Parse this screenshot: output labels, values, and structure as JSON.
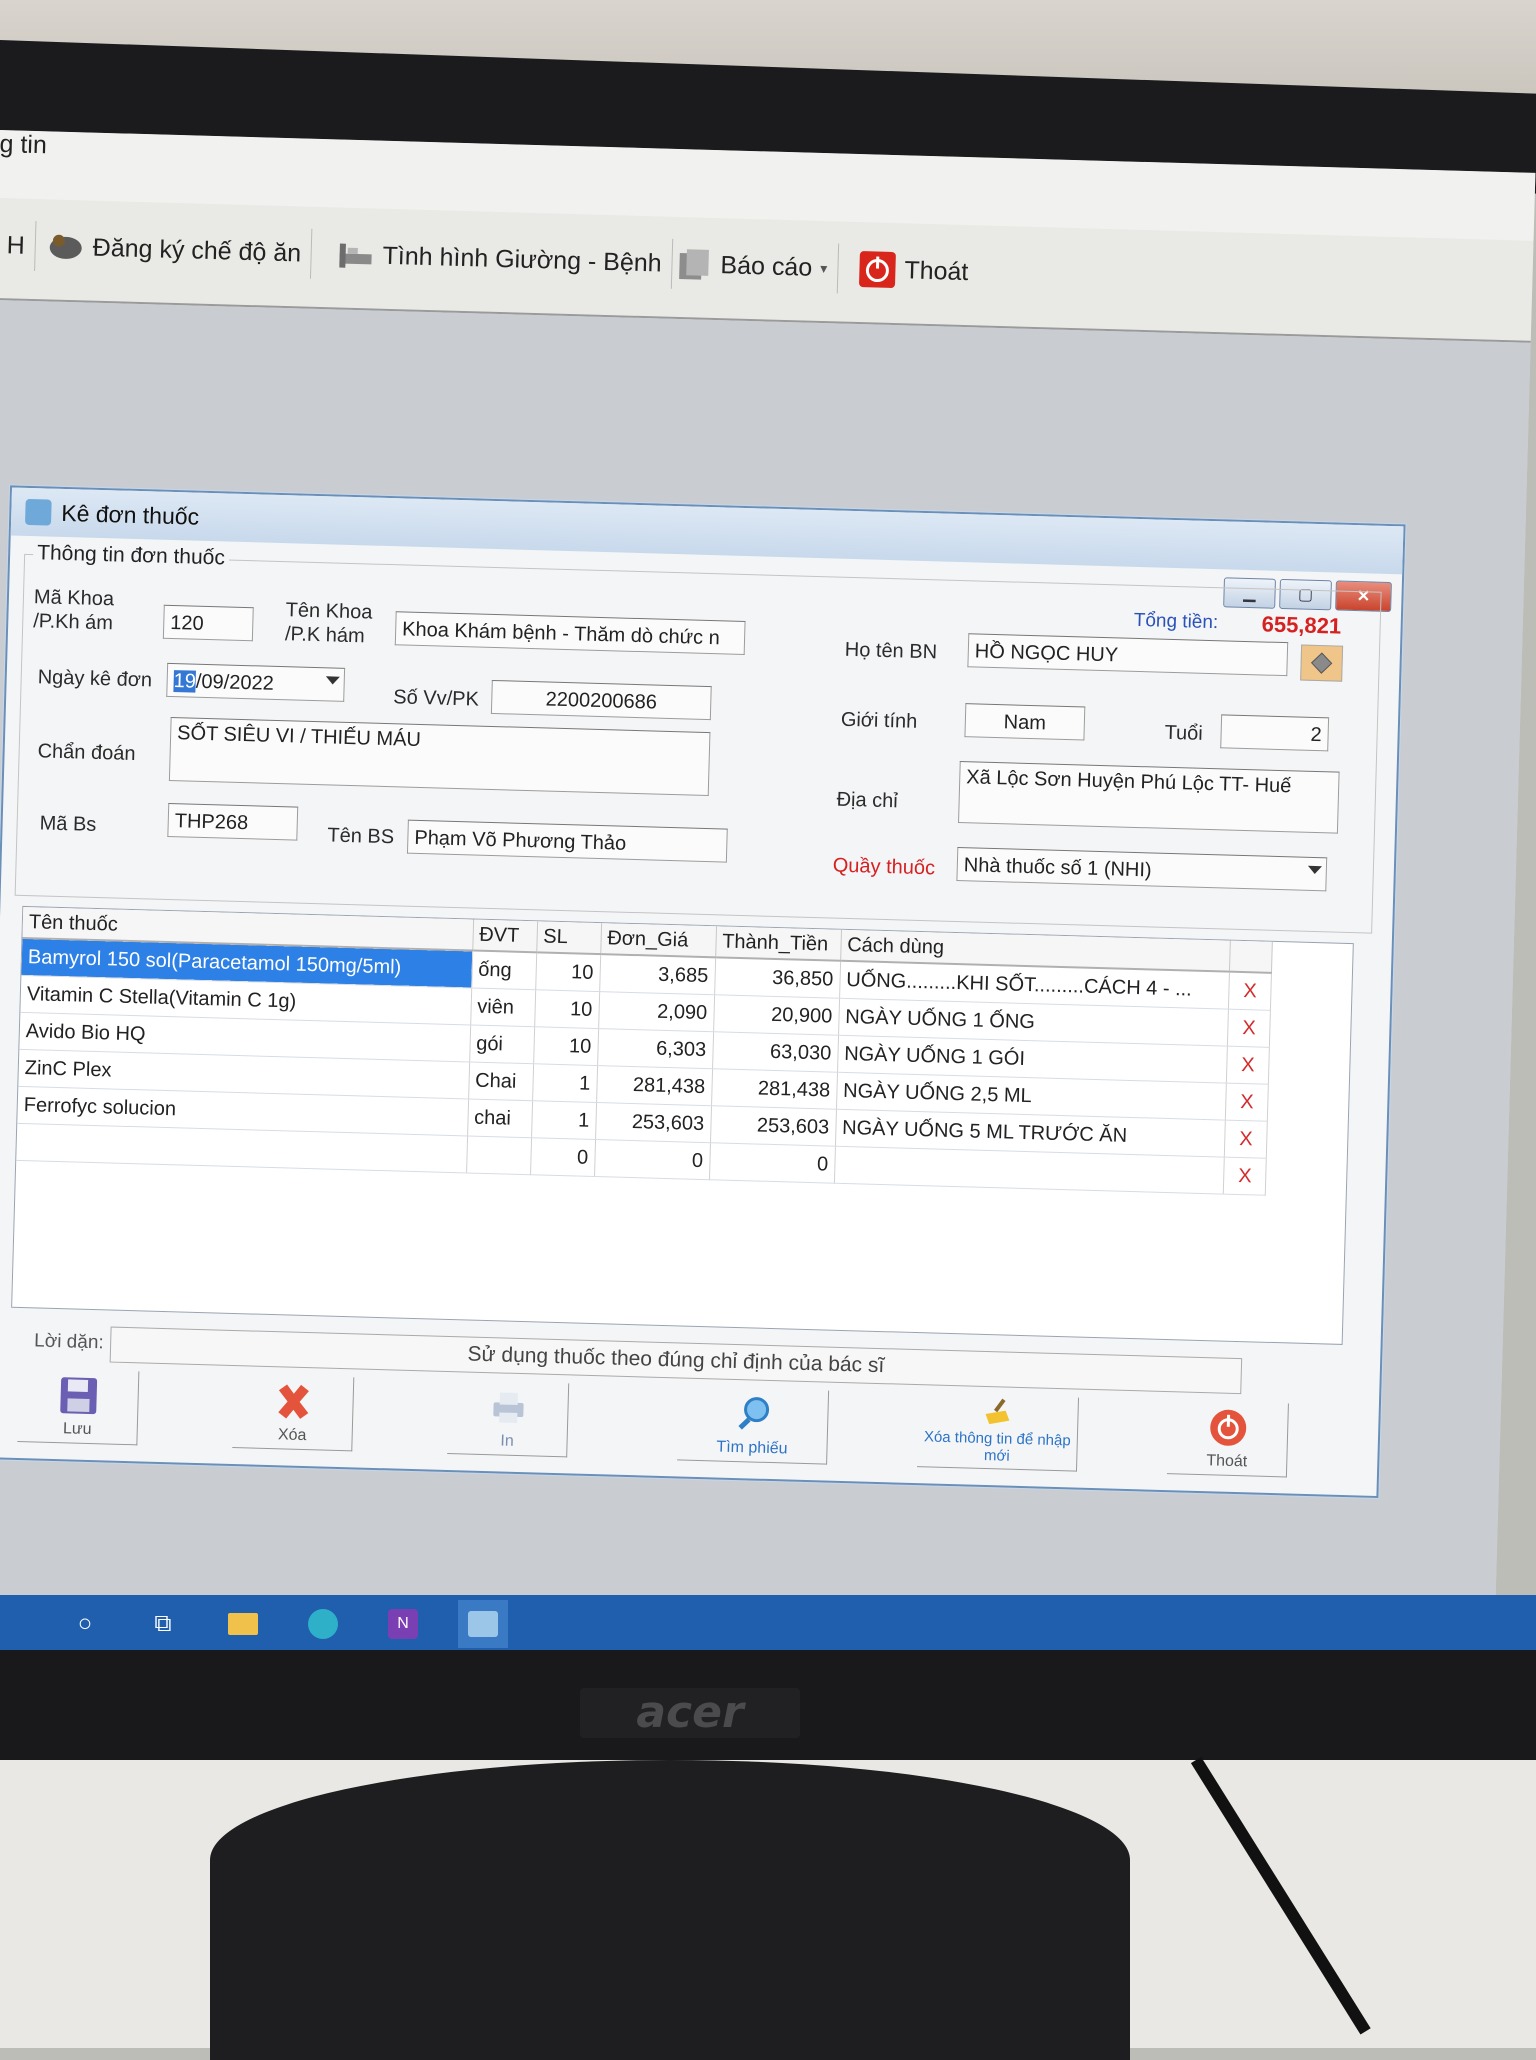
{
  "menubar": {
    "partial_label": "g tin"
  },
  "toolbar": {
    "items": [
      {
        "label": "H"
      },
      {
        "label": "Đăng ký chế độ ăn"
      },
      {
        "label": "Tình hình Giường - Bệnh"
      },
      {
        "label": "Báo cáo"
      },
      {
        "label": "Thoát"
      }
    ]
  },
  "dialog": {
    "title": "Kê đơn thuốc",
    "group_title": "Thông tin đơn thuốc",
    "total_label": "Tổng tiền:",
    "total_value": "655,821",
    "labels": {
      "ma_khoa": "Mã Khoa /P.Kh ám",
      "ten_khoa": "Tên Khoa /P.K hám",
      "ho_ten": "Họ tên BN",
      "ngay_ke_don": "Ngày kê đơn",
      "so_vv": "Số Vv/PK",
      "gioi_tinh": "Giới tính",
      "tuoi": "Tuổi",
      "chan_doan": "Chẩn đoán",
      "dia_chi": "Địa chỉ",
      "ma_bs": "Mã Bs",
      "ten_bs": "Tên BS",
      "quay_thuoc": "Quầy thuốc"
    },
    "fields": {
      "ma_khoa": "120",
      "ten_khoa": "Khoa Khám bệnh - Thăm dò chức n",
      "ho_ten": "HỒ NGỌC HUY",
      "ngay_ke_don_sel": "19",
      "ngay_ke_don_rest": "/09/2022",
      "so_vv": "2200200686",
      "gioi_tinh": "Nam",
      "tuoi": "2",
      "chan_doan": "SỐT SIÊU VI / THIẾU MÁU",
      "dia_chi": "Xã Lộc Sơn Huyện Phú Lộc TT- Huế",
      "ma_bs": "THP268",
      "ten_bs": "Phạm Võ Phương Thảo",
      "quay_thuoc": "Nhà thuốc số 1 (NHI)"
    },
    "grid": {
      "columns": [
        "Tên thuốc",
        "ĐVT",
        "SL",
        "Đơn_Giá",
        "Thành_Tiền",
        "Cách dùng"
      ],
      "rows": [
        [
          "Bamyrol 150 sol(Paracetamol 150mg/5ml)",
          "ống",
          "10",
          "3,685",
          "36,850",
          "UỐNG.........KHI SỐT.........CÁCH 4 - ..."
        ],
        [
          "Vitamin C Stella(Vitamin C 1g)",
          "viên",
          "10",
          "2,090",
          "20,900",
          "NGÀY UỐNG 1 ỐNG"
        ],
        [
          "Avido Bio HQ",
          "gói",
          "10",
          "6,303",
          "63,030",
          "NGÀY UỐNG 1 GÓI"
        ],
        [
          "ZinC Plex",
          "Chai",
          "1",
          "281,438",
          "281,438",
          "NGÀY UỐNG  2,5  ML"
        ],
        [
          "Ferrofyc solucion",
          "chai",
          "1",
          "253,603",
          "253,603",
          "NGÀY UỐNG  5   ML TRƯỚC ĂN"
        ],
        [
          "",
          "",
          "0",
          "0",
          "0",
          ""
        ]
      ],
      "delete_mark": "X"
    },
    "advice_label": "Lời dặn:",
    "advice_text": "Sử dụng thuốc theo đúng chỉ định của bác sĩ",
    "actions": {
      "save": "Lưu",
      "delete": "Xóa",
      "print": "In",
      "find": "Tìm phiếu",
      "clear": "Xóa thông tin để nhập mới",
      "exit": "Thoát"
    }
  },
  "monitor": {
    "brand": "acer"
  },
  "colors": {
    "accent": "#2d80e6",
    "total": "#d62121",
    "quay_label": "#d62121"
  }
}
